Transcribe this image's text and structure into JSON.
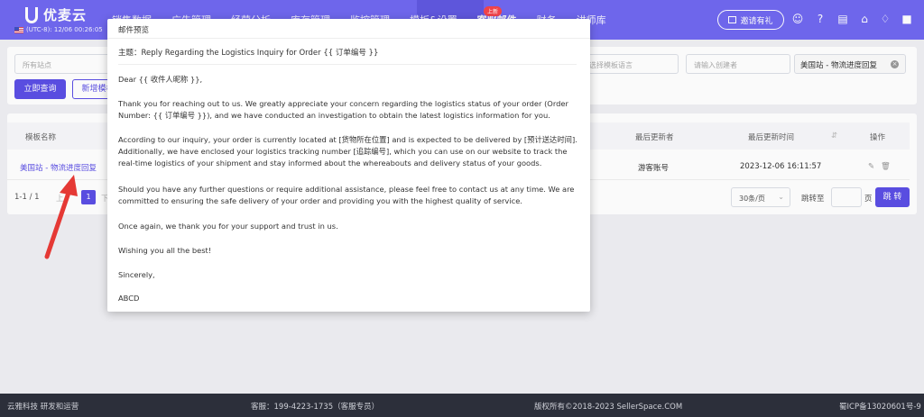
{
  "app": {
    "brand": "优麦云",
    "timezone": "(UTC-8): 12/06 00:26:05"
  },
  "nav": {
    "items": [
      "销售数据",
      "广告管理",
      "经营分析",
      "库存管理",
      "监控管理",
      "模板&设置",
      "客服邮件",
      "财务",
      "讲师库"
    ],
    "active_index": 6,
    "new_badge": "上新",
    "invite_label": "邀请有礼"
  },
  "filters": {
    "site_placeholder": "所有站点",
    "language_placeholder": "选择模板语言",
    "creator_placeholder": "请输入创建者",
    "selected_tag": "美国站 - 物流进度回复",
    "query_button": "立即查询",
    "add_button": "新增模板"
  },
  "table": {
    "headers": {
      "name": "模板名称",
      "updater": "最后更新者",
      "updated_time": "最后更新时间",
      "actions": "操作"
    },
    "rows": [
      {
        "name": "美国站 - 物流进度回复",
        "updater": "游客账号",
        "updated_time": "2023-12-06 16:11:57"
      }
    ]
  },
  "pagination": {
    "range": "1-1 / 1",
    "prev": "上",
    "current_page": "1",
    "next": "下",
    "page_size": "30条/页",
    "jump_label": "跳转至",
    "page_unit": "页",
    "jump_button": "跳 转"
  },
  "footer": {
    "company": "云雅科技 研发和运营",
    "service": "客服：199-4223-1735（客服专员）",
    "copyright": "版权所有©2018-2023 SellerSpace.COM",
    "icp": "蜀ICP备13020601号-9"
  },
  "modal": {
    "title": "邮件预览",
    "subject": "主题：Reply Regarding the Logistics Inquiry for Order {{ 订单编号 }}",
    "paragraphs": [
      "Dear {{ 收件人昵称 }},",
      "Thank you for reaching out to us. We greatly appreciate your concern regarding the logistics status of your order (Order Number: {{ 订单编号 }}), and we have conducted an investigation to obtain the latest logistics information for you.",
      "According to our inquiry, your order is currently located at [货物所在位置] and is expected to be delivered by [预计送达时间]. Additionally, we have enclosed your logistics tracking number [追踪编号], which you can use on our website to track the real-time logistics of your shipment and stay informed about the whereabouts and delivery status of your goods.",
      "Should you have any further questions or require additional assistance, please feel free to contact us at any time. We are committed to ensuring the safe delivery of your order and providing you with the highest quality of service.",
      "Once again, we thank you for your support and trust in us.",
      "Wishing you all the best!",
      "Sincerely,",
      "ABCD"
    ]
  },
  "colors": {
    "primary": "#5b4fe5",
    "nav_bg": "#7169f0",
    "arrow": "#e53935",
    "footer_bg": "#2c2f3a"
  },
  "icons": [
    "logo-icon",
    "flag-icon",
    "gift-icon",
    "user-icon",
    "help-icon",
    "message-icon",
    "cart-icon",
    "bell-icon",
    "account-icon",
    "close-icon",
    "chevron-down-icon",
    "sort-icon",
    "edit-icon",
    "delete-icon",
    "arrow-annotation-icon"
  ]
}
